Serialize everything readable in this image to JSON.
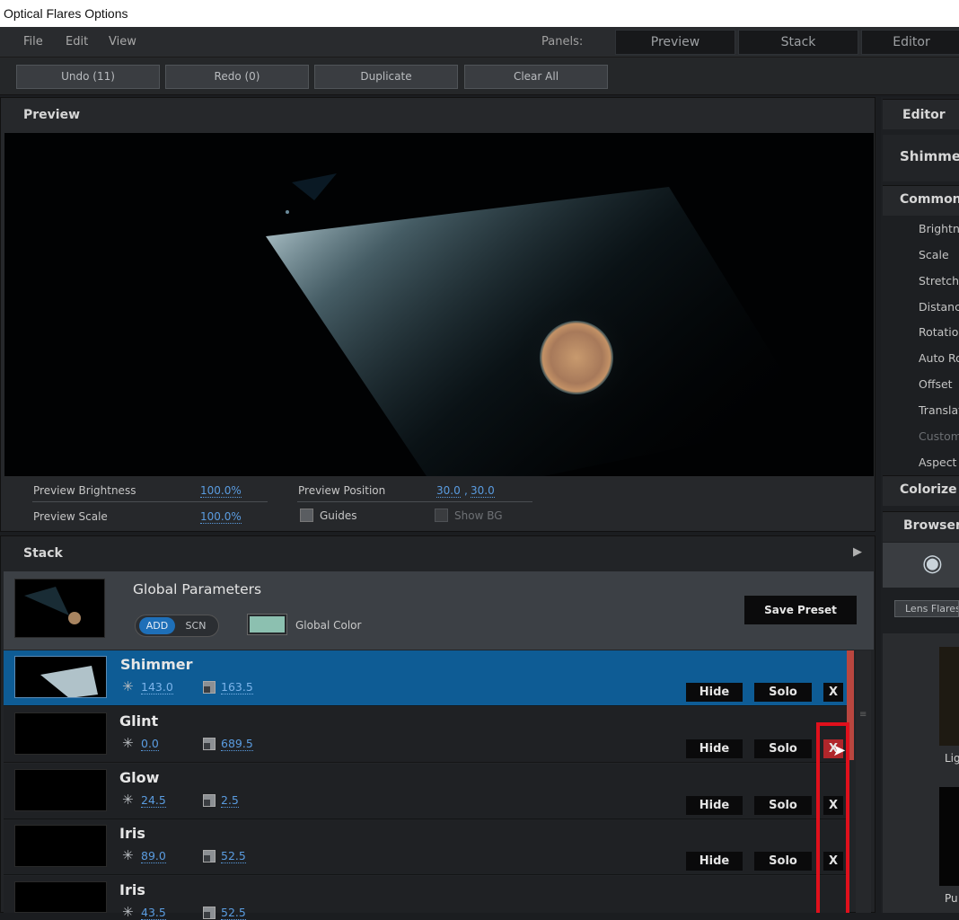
{
  "window": {
    "title": "Optical Flares Options"
  },
  "menu": {
    "file": "File",
    "edit": "Edit",
    "view": "View"
  },
  "panels": {
    "label": "Panels:",
    "preview": "Preview",
    "stack": "Stack",
    "editor": "Editor"
  },
  "toolbar": {
    "undo": "Undo (11)",
    "redo": "Redo (0)",
    "duplicate": "Duplicate",
    "clear_all": "Clear All"
  },
  "preview": {
    "title": "Preview",
    "brightness_label": "Preview Brightness",
    "brightness_value": "100.0%",
    "scale_label": "Preview Scale",
    "scale_value": "100.0%",
    "position_label": "Preview Position",
    "position_x": "30.0",
    "position_sep": ",",
    "position_y": "30.0",
    "guides_label": "Guides",
    "show_bg_label": "Show BG"
  },
  "stack": {
    "title": "Stack",
    "global_title": "Global Parameters",
    "add": "ADD",
    "scn": "SCN",
    "global_color_label": "Global Color",
    "global_color": "#8cc0b0",
    "save_preset": "Save Preset",
    "hide": "Hide",
    "solo": "Solo",
    "x": "X",
    "layers": [
      {
        "name": "Shimmer",
        "brightness": "143.0",
        "scale": "163.5",
        "selected": true
      },
      {
        "name": "Glint",
        "brightness": "0.0",
        "scale": "689.5"
      },
      {
        "name": "Glow",
        "brightness": "24.5",
        "scale": "2.5"
      },
      {
        "name": "Iris",
        "brightness": "89.0",
        "scale": "52.5"
      },
      {
        "name": "Iris",
        "brightness": "43.5",
        "scale": "52.5"
      }
    ]
  },
  "editor": {
    "title": "Editor",
    "element_name": "Shimmer",
    "common_title": "Common",
    "items": [
      "Brightness",
      "Scale",
      "Stretch",
      "Distance",
      "Rotation",
      "Auto Rotate",
      "Offset",
      "Translation",
      "Custom",
      "Aspect"
    ],
    "colorize_title": "Colorize",
    "browser_title": "Browser",
    "lens_flares": "Lens Flares",
    "thumb_label_1": "Lig",
    "thumb_label_2": "Pu"
  },
  "colors": {
    "accent": "#0e5c95",
    "highlight": "#e0101c",
    "link": "#5a9ce0"
  }
}
